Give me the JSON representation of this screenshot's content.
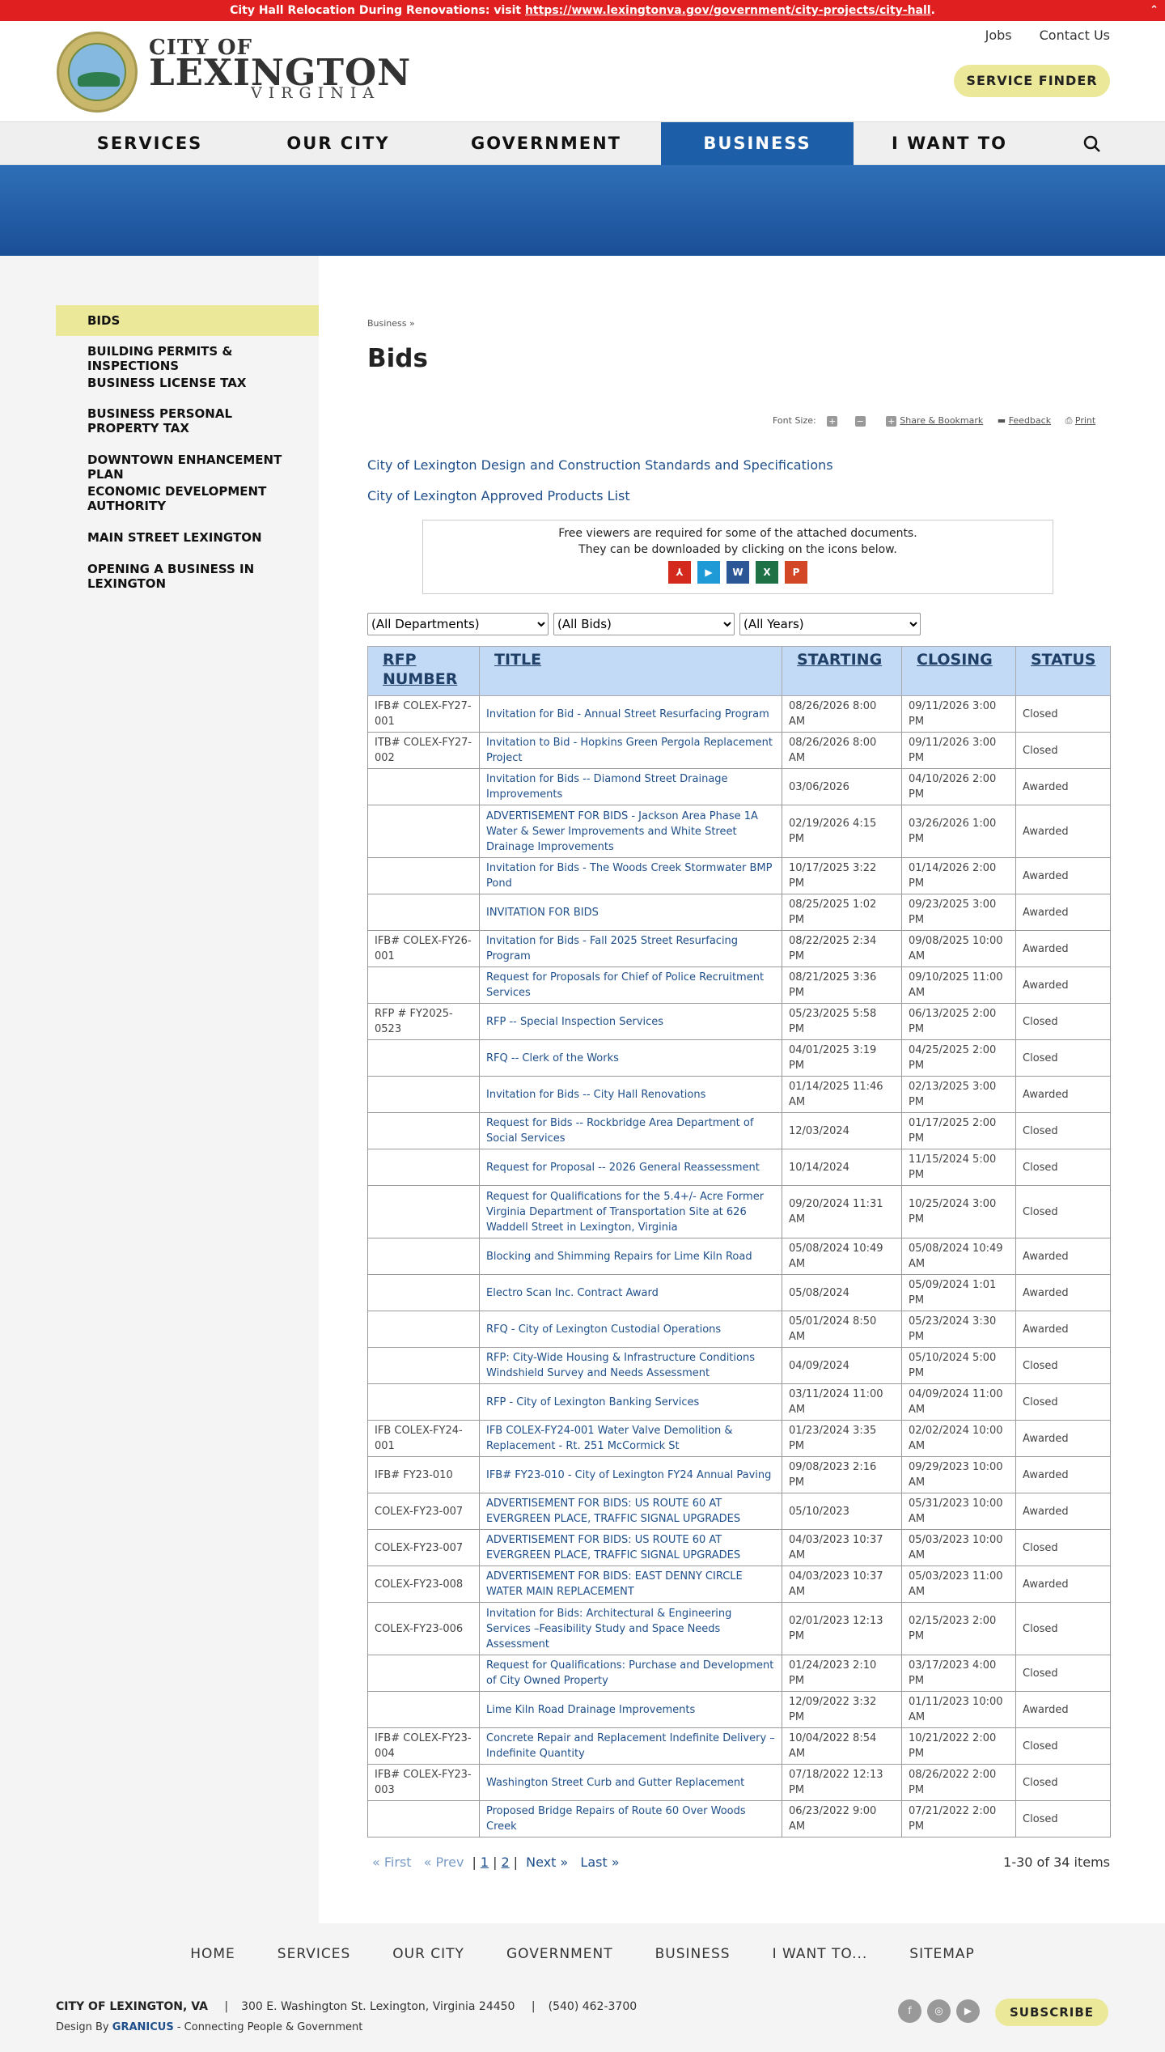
{
  "alert": {
    "text": "City Hall Relocation During Renovations: visit ",
    "link": "https://www.lexingtonva.gov/government/city-projects/city-hall",
    "tail": "."
  },
  "brand": {
    "city": "CITY OF",
    "name": "LEXINGTON",
    "state": "VIRGINIA"
  },
  "toplinks": [
    "Jobs",
    "Contact Us"
  ],
  "service_finder": "SERVICE FINDER",
  "nav": [
    {
      "label": "SERVICES"
    },
    {
      "label": "OUR CITY"
    },
    {
      "label": "GOVERNMENT"
    },
    {
      "label": "BUSINESS",
      "active": true
    },
    {
      "label": "I WANT TO"
    }
  ],
  "sidebar": [
    "BIDS",
    "BUILDING PERMITS & INSPECTIONS",
    "BUSINESS LICENSE TAX",
    "BUSINESS PERSONAL PROPERTY TAX",
    "DOWNTOWN ENHANCEMENT PLAN",
    "ECONOMIC DEVELOPMENT AUTHORITY",
    "MAIN STREET LEXINGTON",
    "OPENING A BUSINESS IN LEXINGTON"
  ],
  "breadcrumb": "Business »",
  "title": "Bids",
  "tools": {
    "font_size": "Font Size:",
    "plus": "+",
    "minus": "−",
    "share": "Share & Bookmark",
    "feedback": "Feedback",
    "print": "Print"
  },
  "links": [
    "City of Lexington Design and Construction Standards and Specifications",
    "City of Lexington Approved Products List"
  ],
  "viewers": {
    "line1": "Free viewers are required for some of the attached documents.",
    "line2": "They can be downloaded by clicking on the icons below.",
    "icons": [
      {
        "name": "pdf-icon",
        "glyph": "⅄",
        "color": "#d42a1e"
      },
      {
        "name": "media-icon",
        "glyph": "▶",
        "color": "#1e9bd7"
      },
      {
        "name": "word-icon",
        "glyph": "W",
        "color": "#2b5797"
      },
      {
        "name": "excel-icon",
        "glyph": "X",
        "color": "#1e7145"
      },
      {
        "name": "powerpoint-icon",
        "glyph": "P",
        "color": "#d24726"
      }
    ]
  },
  "filters": [
    "(All Departments)",
    "(All Bids)",
    "(All Years)"
  ],
  "table": {
    "headers": [
      "RFP NUMBER",
      "TITLE",
      "STARTING",
      "CLOSING",
      "STATUS"
    ],
    "rows": [
      [
        "IFB# COLEX-FY27-001",
        "Invitation for Bid - Annual Street Resurfacing Program",
        "08/26/2026 8:00 AM",
        "09/11/2026 3:00 PM",
        "Closed"
      ],
      [
        "ITB# COLEX-FY27-002",
        "Invitation to Bid - Hopkins Green Pergola Replacement Project",
        "08/26/2026 8:00 AM",
        "09/11/2026 3:00 PM",
        "Closed"
      ],
      [
        "",
        "Invitation for Bids -- Diamond Street Drainage Improvements",
        "03/06/2026",
        "04/10/2026 2:00 PM",
        "Awarded"
      ],
      [
        "",
        "ADVERTISEMENT FOR BIDS - Jackson Area Phase 1A Water & Sewer Improvements and White Street Drainage Improvements",
        "02/19/2026 4:15 PM",
        "03/26/2026 1:00 PM",
        "Awarded"
      ],
      [
        "",
        "Invitation for Bids - The Woods Creek Stormwater BMP Pond",
        "10/17/2025 3:22 PM",
        "01/14/2026 2:00 PM",
        "Awarded"
      ],
      [
        "",
        "INVITATION FOR BIDS",
        "08/25/2025 1:02 PM",
        "09/23/2025 3:00 PM",
        "Awarded"
      ],
      [
        "IFB# COLEX-FY26-001",
        "Invitation for Bids - Fall 2025 Street Resurfacing Program",
        "08/22/2025 2:34 PM",
        "09/08/2025 10:00 AM",
        "Awarded"
      ],
      [
        "",
        "Request for Proposals for Chief of Police Recruitment Services",
        "08/21/2025 3:36 PM",
        "09/10/2025 11:00 AM",
        "Awarded"
      ],
      [
        "RFP # FY2025-0523",
        "RFP -- Special Inspection Services",
        "05/23/2025 5:58 PM",
        "06/13/2025 2:00 PM",
        "Closed"
      ],
      [
        "",
        "RFQ -- Clerk of the Works",
        "04/01/2025 3:19 PM",
        "04/25/2025 2:00 PM",
        "Closed"
      ],
      [
        "",
        "Invitation for Bids -- City Hall Renovations",
        "01/14/2025 11:46 AM",
        "02/13/2025 3:00 PM",
        "Awarded"
      ],
      [
        "",
        "Request for Bids -- Rockbridge Area Department of Social Services",
        "12/03/2024",
        "01/17/2025 2:00 PM",
        "Closed"
      ],
      [
        "",
        "Request for Proposal -- 2026 General Reassessment",
        "10/14/2024",
        "11/15/2024 5:00 PM",
        "Closed"
      ],
      [
        "",
        "Request for Qualifications for the 5.4+/- Acre Former Virginia Department of Transportation Site at 626 Waddell Street in Lexington, Virginia",
        "09/20/2024 11:31 AM",
        "10/25/2024 3:00 PM",
        "Closed"
      ],
      [
        "",
        "Blocking and Shimming Repairs for Lime Kiln Road",
        "05/08/2024 10:49 AM",
        "05/08/2024 10:49 AM",
        "Awarded"
      ],
      [
        "",
        "Electro Scan Inc. Contract Award",
        "05/08/2024",
        "05/09/2024 1:01 PM",
        "Awarded"
      ],
      [
        "",
        "RFQ - City of Lexington Custodial Operations",
        "05/01/2024 8:50 AM",
        "05/23/2024 3:30 PM",
        "Awarded"
      ],
      [
        "",
        "RFP: City-Wide Housing & Infrastructure Conditions Windshield Survey and Needs Assessment",
        "04/09/2024",
        "05/10/2024 5:00 PM",
        "Closed"
      ],
      [
        "",
        "RFP - City of Lexington Banking Services",
        "03/11/2024 11:00 AM",
        "04/09/2024 11:00 AM",
        "Closed"
      ],
      [
        "IFB COLEX-FY24-001",
        "IFB COLEX-FY24-001 Water Valve Demolition & Replacement - Rt. 251 McCormick St",
        "01/23/2024 3:35 PM",
        "02/02/2024 10:00 AM",
        "Awarded"
      ],
      [
        "IFB# FY23-010",
        "IFB# FY23-010 - City of Lexington FY24 Annual Paving",
        "09/08/2023 2:16 PM",
        "09/29/2023 10:00 AM",
        "Awarded"
      ],
      [
        "COLEX-FY23-007",
        "ADVERTISEMENT FOR BIDS: US ROUTE 60 AT EVERGREEN PLACE, TRAFFIC SIGNAL UPGRADES",
        "05/10/2023",
        "05/31/2023 10:00 AM",
        "Awarded"
      ],
      [
        "COLEX-FY23-007",
        "ADVERTISEMENT FOR BIDS: US ROUTE 60 AT EVERGREEN PLACE, TRAFFIC SIGNAL UPGRADES",
        "04/03/2023 10:37 AM",
        "05/03/2023 10:00 AM",
        "Closed"
      ],
      [
        "COLEX-FY23-008",
        "ADVERTISEMENT FOR BIDS: EAST DENNY CIRCLE WATER MAIN REPLACEMENT",
        "04/03/2023 10:37 AM",
        "05/03/2023 11:00 AM",
        "Awarded"
      ],
      [
        "COLEX-FY23-006",
        "Invitation for Bids: Architectural & Engineering Services –Feasibility Study and Space Needs Assessment",
        "02/01/2023 12:13 PM",
        "02/15/2023 2:00 PM",
        "Closed"
      ],
      [
        "",
        "Request for Qualifications: Purchase and Development of City Owned Property",
        "01/24/2023 2:10 PM",
        "03/17/2023 4:00 PM",
        "Closed"
      ],
      [
        "",
        "Lime Kiln Road Drainage Improvements",
        "12/09/2022 3:32 PM",
        "01/11/2023 10:00 AM",
        "Awarded"
      ],
      [
        "IFB# COLEX-FY23-004",
        "Concrete Repair and Replacement Indefinite Delivery – Indefinite Quantity",
        "10/04/2022 8:54 AM",
        "10/21/2022 2:00 PM",
        "Closed"
      ],
      [
        "IFB# COLEX-FY23-003",
        "Washington Street Curb and Gutter Replacement",
        "07/18/2022 12:13 PM",
        "08/26/2022 2:00 PM",
        "Closed"
      ],
      [
        "",
        "Proposed Bridge Repairs of Route 60 Over Woods Creek",
        "06/23/2022 9:00 AM",
        "07/21/2022 2:00 PM",
        "Closed"
      ]
    ]
  },
  "pager": {
    "first": "« First",
    "prev": "« Prev",
    "p1": "1",
    "p2": "2",
    "next": "Next »",
    "last": "Last »",
    "sep": "|",
    "count": "1-30 of 34 items"
  },
  "footer": {
    "nav": [
      "HOME",
      "SERVICES",
      "OUR CITY",
      "GOVERNMENT",
      "BUSINESS",
      "I WANT TO...",
      "SITEMAP"
    ],
    "name": "CITY OF LEXINGTON, VA",
    "sep": "|",
    "address": "300 E. Washington St. Lexington, Virginia 24450",
    "phone": "(540) 462-3700",
    "design_by": "Design By",
    "granicus": "GRANICUS",
    "tagline": "- Connecting People & Government",
    "subscribe": "SUBSCRIBE",
    "social": [
      "facebook-icon",
      "instagram-icon",
      "youtube-icon"
    ]
  }
}
